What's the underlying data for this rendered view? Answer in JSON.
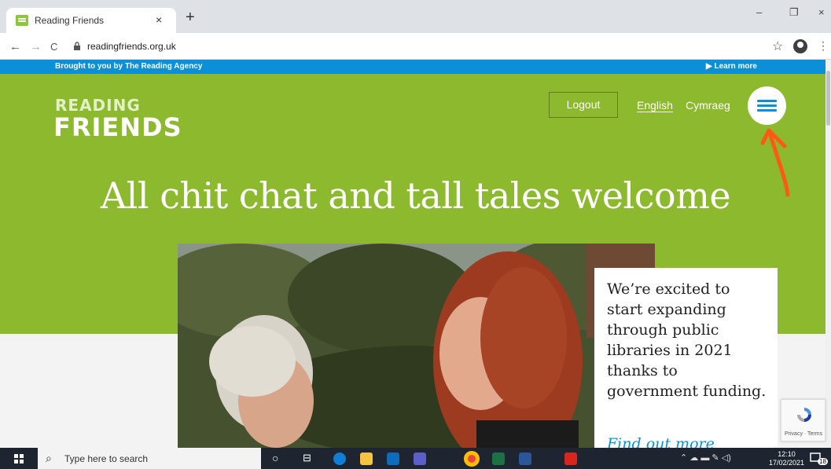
{
  "browser": {
    "tab_title": "Reading Friends",
    "tab_close": "×",
    "new_tab": "+",
    "window_controls": {
      "minimize": "–",
      "maximize": "❐",
      "close": "×"
    },
    "nav": {
      "back": "←",
      "forward": "→",
      "reload": "C"
    },
    "url": "readingfriends.org.uk",
    "star": "☆",
    "menu": "⋮"
  },
  "site": {
    "top_strip": {
      "brought_prefix": "Brought to you by ",
      "brought_org": "The Reading Agency",
      "learn_more": "▶ Learn more"
    },
    "logo": {
      "line1": "READING",
      "line2": "FRIENDS"
    },
    "header": {
      "logout_label": "Logout",
      "lang_english": "English",
      "lang_welsh": "Cymraeg"
    },
    "headline": "All chit chat and tall tales welcome",
    "card": {
      "text": "We’re excited to start expanding through public libraries in 2021 thanks to government funding.",
      "link": "Find out more"
    },
    "recaptcha": {
      "links": "Privacy · Terms"
    }
  },
  "taskbar": {
    "search_placeholder": "Type here to search",
    "time": "12:10",
    "date": "17/02/2021",
    "notifications": "18",
    "icon_colors": {
      "edge": "#0f7fd6",
      "explorer": "#f5c542",
      "outlook": "#0f6cbd",
      "teams": "#5b5fc7",
      "chrome": "#e8453c",
      "excel": "#1e7145",
      "word": "#2b579a",
      "acrobat": "#d7261e"
    }
  },
  "annotation_color": "#ff5a14"
}
